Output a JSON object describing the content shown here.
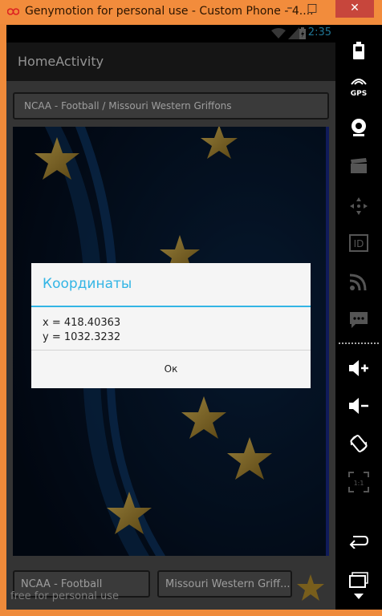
{
  "window": {
    "title": "Genymotion for personal use - Custom Phone - 4....",
    "minimize_glyph": "–",
    "maximize_glyph": "□",
    "close_glyph": "✕"
  },
  "statusbar": {
    "time": "2:35"
  },
  "actionbar": {
    "title": "HomeActivity"
  },
  "top_spinner": {
    "value": "NCAA - Football / Missouri Western Griffons"
  },
  "bottom": {
    "league_spinner": "NCAA - Football",
    "team_spinner": "Missouri Western Griff..."
  },
  "dialog": {
    "title": "Координаты",
    "line_x": "x = 418.40363",
    "line_y": "y = 1032.3232",
    "ok_label": "Ок"
  },
  "watermark": "free for personal use",
  "sidebar": {
    "gps_label": "GPS",
    "id_label": "ID",
    "pixel_label": "1:1"
  },
  "colors": {
    "accent": "#33b5e5",
    "titlebar": "#f28c3c",
    "close": "#c7463c",
    "star_gold": "#b8912c",
    "image_bg": "#06172f"
  }
}
